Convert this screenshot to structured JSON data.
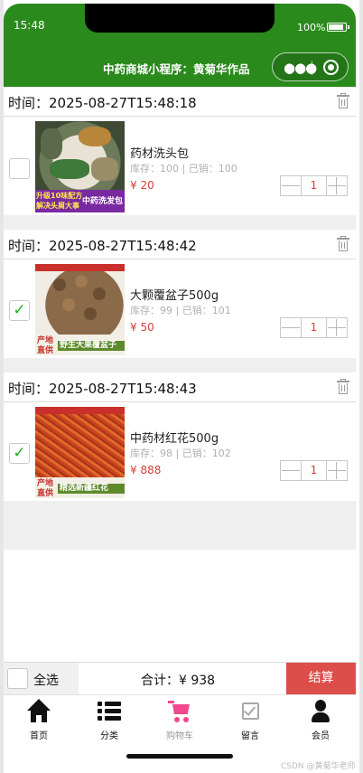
{
  "status_bar": {
    "time": "15:48",
    "battery": "100%"
  },
  "nav": {
    "title": "中药商城小程序：黄菊华作品",
    "more_icon": "more-dots-icon",
    "close_icon": "target-icon"
  },
  "cart_items": [
    {
      "time_prefix": "时间：",
      "time": "2025-08-27T15:48:18",
      "name": "药材洗头包",
      "stock_label": "库存：",
      "stock": "100",
      "sales_label": " | 已销：",
      "sales": "100",
      "price_prefix": "¥ ",
      "price": "20",
      "qty": "1",
      "checked": false,
      "image_caption_1": "升级10味配方 解决头屑大事",
      "image_caption_2": "中药洗发包",
      "image_color": "#6d7a5a"
    },
    {
      "time_prefix": "时间：",
      "time": "2025-08-27T15:48:42",
      "name": "大颗覆盆子500g",
      "stock_label": "库存：",
      "stock": "99",
      "sales_label": " | 已销：",
      "sales": "101",
      "price_prefix": "¥ ",
      "price": "50",
      "qty": "1",
      "checked": true,
      "image_caption_1": "产地 直供",
      "image_caption_2": "野生大果覆盆子",
      "image_color": "#8a6a48"
    },
    {
      "time_prefix": "时间：",
      "time": "2025-08-27T15:48:43",
      "name": "中药材红花500g",
      "stock_label": "库存：",
      "stock": "98",
      "sales_label": " | 已销：",
      "sales": "102",
      "price_prefix": "¥ ",
      "price": "888",
      "qty": "1",
      "checked": true,
      "image_caption_1": "产地 直供",
      "image_caption_2": "精选新疆红花",
      "image_color": "#c8431e"
    }
  ],
  "checkout": {
    "select_all": "全选",
    "total_label": "合计：¥ ",
    "total": "938",
    "settle": "结算"
  },
  "tabs": [
    {
      "label": "首页",
      "icon": "home-icon"
    },
    {
      "label": "分类",
      "icon": "list-icon"
    },
    {
      "label": "购物车",
      "icon": "cart-icon",
      "active_color": "#ef4a8d"
    },
    {
      "label": "留言",
      "icon": "message-check-icon"
    },
    {
      "label": "会员",
      "icon": "user-icon"
    }
  ],
  "watermark": "CSDN @黄菊华老师",
  "colors": {
    "nav_bg": "#2a8a1c",
    "price": "#d5403a",
    "settle_bg": "#dd4d49",
    "check": "#1fb01f",
    "cart_tab": "#ef4a8d"
  }
}
